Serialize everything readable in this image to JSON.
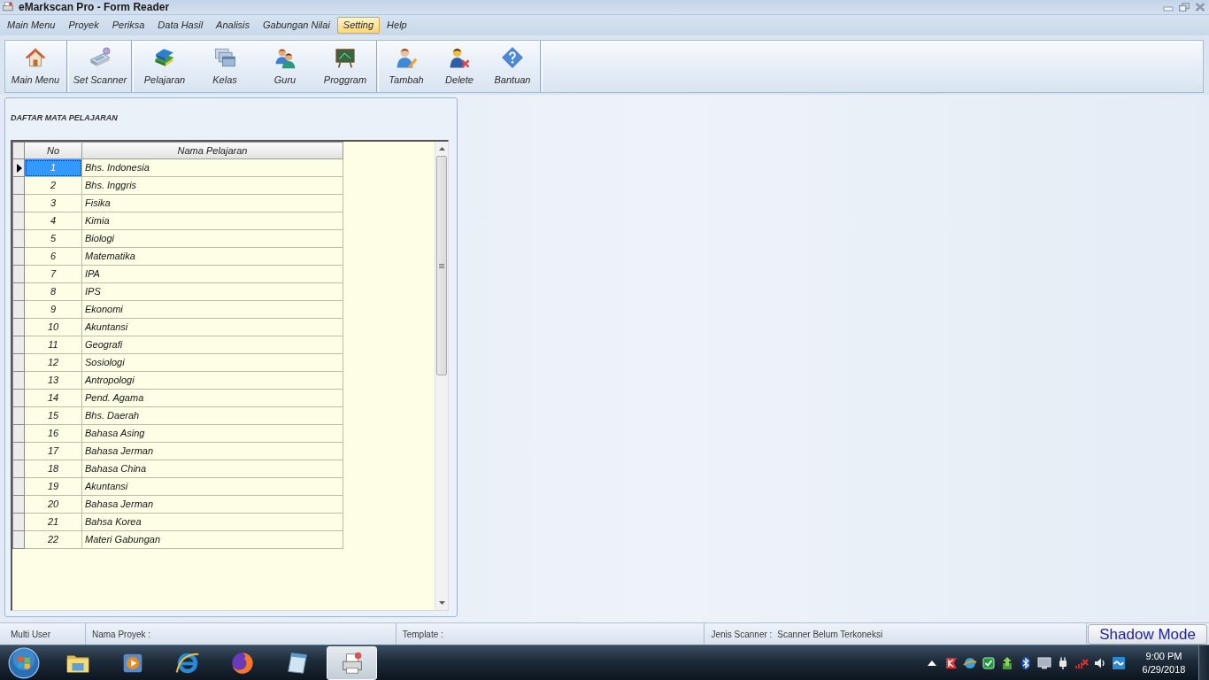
{
  "window": {
    "title": "eMarkscan Pro - Form Reader"
  },
  "menu": [
    {
      "label": "Main Menu",
      "selected": false
    },
    {
      "label": "Proyek",
      "selected": false
    },
    {
      "label": "Periksa",
      "selected": false
    },
    {
      "label": "Data Hasil",
      "selected": false
    },
    {
      "label": "Analisis",
      "selected": false
    },
    {
      "label": "Gabungan Nilai",
      "selected": false
    },
    {
      "label": "Setting",
      "selected": true
    },
    {
      "label": "Help",
      "selected": false
    }
  ],
  "toolbar": {
    "groups": [
      {
        "buttons": [
          {
            "label": "Main Menu"
          }
        ]
      },
      {
        "buttons": [
          {
            "label": "Set Scanner"
          }
        ]
      },
      {
        "buttons": [
          {
            "label": "Pelajaran"
          },
          {
            "label": "Kelas"
          },
          {
            "label": "Guru"
          },
          {
            "label": "Proggram"
          }
        ]
      },
      {
        "buttons": [
          {
            "label": "Tambah"
          },
          {
            "label": "Delete"
          },
          {
            "label": "Bantuan"
          }
        ]
      }
    ]
  },
  "panel": {
    "title": "DAFTAR MATA PELAJARAN",
    "table": {
      "columns": [
        "No",
        "Nama Pelajaran"
      ],
      "rows": [
        {
          "cells": [
            "1",
            "Bhs. Indonesia"
          ],
          "selected": true
        },
        {
          "cells": [
            "2",
            "Bhs. Inggris"
          ],
          "selected": false
        },
        {
          "cells": [
            "3",
            "Fisika"
          ],
          "selected": false
        },
        {
          "cells": [
            "4",
            "Kimia"
          ],
          "selected": false
        },
        {
          "cells": [
            "5",
            "Biologi"
          ],
          "selected": false
        },
        {
          "cells": [
            "6",
            "Matematika"
          ],
          "selected": false
        },
        {
          "cells": [
            "7",
            "IPA"
          ],
          "selected": false
        },
        {
          "cells": [
            "8",
            "IPS"
          ],
          "selected": false
        },
        {
          "cells": [
            "9",
            "Ekonomi"
          ],
          "selected": false
        },
        {
          "cells": [
            "10",
            "Akuntansi"
          ],
          "selected": false
        },
        {
          "cells": [
            "11",
            "Geografi"
          ],
          "selected": false
        },
        {
          "cells": [
            "12",
            "Sosiologi"
          ],
          "selected": false
        },
        {
          "cells": [
            "13",
            "Antropologi"
          ],
          "selected": false
        },
        {
          "cells": [
            "14",
            "Pend. Agama"
          ],
          "selected": false
        },
        {
          "cells": [
            "15",
            "Bhs. Daerah"
          ],
          "selected": false
        },
        {
          "cells": [
            "16",
            "Bahasa Asing"
          ],
          "selected": false
        },
        {
          "cells": [
            "17",
            "Bahasa Jerman"
          ],
          "selected": false
        },
        {
          "cells": [
            "18",
            "Bahasa China"
          ],
          "selected": false
        },
        {
          "cells": [
            "19",
            "Akuntansi"
          ],
          "selected": false
        },
        {
          "cells": [
            "20",
            "Bahasa Jerman"
          ],
          "selected": false
        },
        {
          "cells": [
            "21",
            "Bahsa Korea"
          ],
          "selected": false
        },
        {
          "cells": [
            "22",
            "Materi Gabungan"
          ],
          "selected": false
        }
      ]
    }
  },
  "status_bar": {
    "sections": [
      {
        "label": "Multi User"
      },
      {
        "label": "Nama Proyek :"
      },
      {
        "label": "Template :"
      },
      {
        "label": "Jenis Scanner :",
        "value": "Scanner Belum Terkoneksi"
      }
    ],
    "button": "Shadow Mode"
  },
  "taskbar": {
    "apps": [
      {
        "selected": false
      },
      {
        "selected": false
      },
      {
        "selected": false
      },
      {
        "selected": false
      },
      {
        "selected": false
      },
      {
        "selected": true
      }
    ],
    "clock": {
      "time": "9:00 PM",
      "date": "6/29/2018"
    }
  }
}
